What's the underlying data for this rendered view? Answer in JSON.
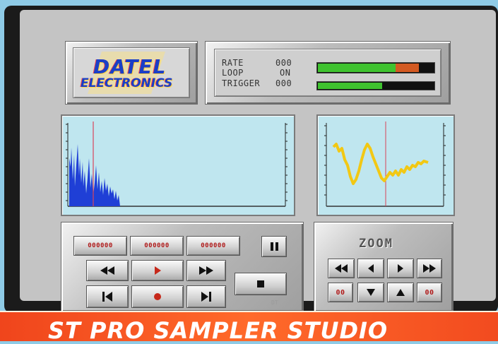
{
  "logo": {
    "line1": "DATEL",
    "line2": "ELECTRONICS"
  },
  "status": {
    "rows": [
      {
        "label": "RATE",
        "value": "000"
      },
      {
        "label": "LOOP",
        "value": "ON"
      },
      {
        "label": "TRIGGER",
        "value": "000"
      }
    ],
    "meters": [
      {
        "level": 0.86,
        "green_fraction": 0.66,
        "color_main": "#3fc22f",
        "color_peak": "#d35a22"
      },
      {
        "level": 0.55,
        "color_main": "#3fc22f"
      }
    ]
  },
  "transport": {
    "counters": [
      "000000",
      "000000",
      "000000"
    ],
    "pause_icon": "pause-icon",
    "rewind_icon": "rewind-icon",
    "play_icon": "play-icon",
    "fast_forward_icon": "fast-forward-icon",
    "skip_start_icon": "skip-start-icon",
    "record_icon": "record-icon",
    "skip_end_icon": "skip-end-icon",
    "stop_icon": "stop-icon",
    "tag": "DT"
  },
  "zoom": {
    "title": "ZOOM",
    "left_value": "00",
    "right_value": "00"
  },
  "banner": {
    "text": "ST PRO SAMPLER STUDIO"
  },
  "colors": {
    "waveform": "#1f3fd6",
    "scope_trace": "#f2c814",
    "cursor": "#d9445a",
    "banner": "#f0451c"
  }
}
